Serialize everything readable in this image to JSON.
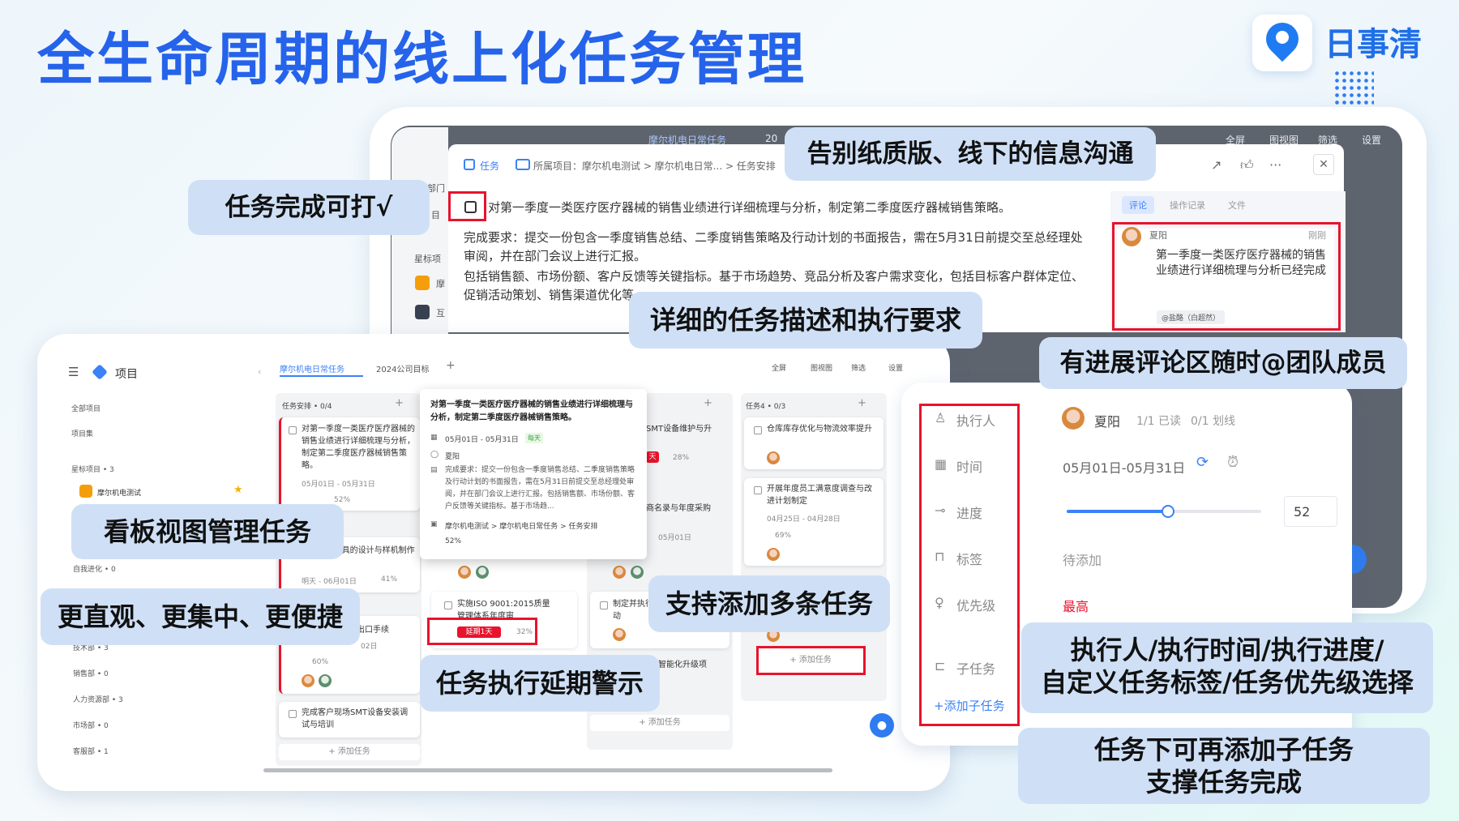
{
  "headline": "全生命周期的线上化任务管理",
  "brand": {
    "name": "日事清",
    "color": "#1f6fe8"
  },
  "colors": {
    "accent": "#2563eb",
    "alert": "#e8132c",
    "callout_bg": "#cfe0f6"
  },
  "callouts": {
    "complete": "任务完成可打√",
    "paperless": "告别纸质版、线下的信息沟通",
    "description": "详细的任务描述和执行要求",
    "comment": "有进展评论区随时@团队成员",
    "kanban": "看板视图管理任务",
    "intuitive": "更直观、更集中、更便捷",
    "multi": "支持添加多条任务",
    "delay": "任务执行延期警示",
    "fields_line1": "执行人/执行时间/执行进度/",
    "fields_line2": "自定义任务标签/任务优先级选择",
    "subtask_line1": "任务下可再添加子任务",
    "subtask_line2": "支撑任务完成"
  },
  "back_window": {
    "nav_title": "项目",
    "tab_active": "摩尔机电日常任务",
    "tab_other": "20",
    "toolbar": [
      "全屏",
      "图视图",
      "筛选",
      "设置"
    ],
    "strip_items": [
      "部门",
      "目",
      "星标项",
      "摩",
      "互"
    ]
  },
  "modal": {
    "type_tag": "任务",
    "breadcrumb": "所属项目：摩尔机电测试 > 摩尔机电日常... > 任务安排",
    "task_title": "对第一季度一类医疗医疗器械的销售业绩进行详细梳理与分析，制定第二季度医疗器械销售策略。",
    "para1": "完成要求：提交一份包含一季度销售总结、二季度销售策略及行动计划的书面报告，需在5月31日前提交至总经理处审阅，并在部门会议上进行汇报。",
    "para2": "包括销售额、市场份额、客户反馈等关键指标。基于市场趋势、竞品分析及客户需求变化，包括目标客户群体定位、促销活动策划、销售渠道优化等。",
    "side_tabs": [
      "评论",
      "操作记录",
      "文件"
    ],
    "comment": {
      "user": "夏阳",
      "time": "刚刚",
      "text": "第一季度一类医疗医疗器械的销售业绩进行详细梳理与分析已经完成",
      "mention": "@盐酪（白超然）"
    }
  },
  "front_window": {
    "nav_title": "项目",
    "tab_active": "摩尔机电日常任务",
    "tab_other": "2024公司目标",
    "toolbar": [
      "全屏",
      "图视图",
      "筛选",
      "设置"
    ],
    "sidebar": {
      "all": "全部项目",
      "sets": "项目集",
      "starred": "星标项目 • 3",
      "starred_item": "摩尔机电测试",
      "groups": [
        "自我进化 • 0",
        "技术部 • 3",
        "销售部 • 0",
        "人力资源部 • 3",
        "市场部 • 0",
        "客服部 • 1"
      ]
    },
    "col1": {
      "header": "任务安排 • 0/4",
      "card1_text": "对第一季度一类医疗医疗器械的销售业绩进行详细梳理与分析，制定第二季度医疗器械销售策略。",
      "card1_date": "05月01日 - 05月31日",
      "card1_pct": "52%",
      "card2_text": "LED照明灯具的设计与样机制作",
      "card2_date": "明天 - 06月01日",
      "card2_pct": "41%",
      "card3_text": "出口手续",
      "card3_date": "02日",
      "card3_pct": "60%",
      "card4_text": "完成客户现场SMT设备安装调试与培训",
      "add": "+ 添加任务"
    },
    "popup": {
      "title": "对第一季度一类医疗医疗器械的销售业绩进行详细梳理与分析，制定第二季度医疗器械销售策略。",
      "date": "05月01日 - 05月31日",
      "date_tag": "每天",
      "owner": "夏阳",
      "desc": "完成要求：提交一份包含一季度销售总结、二季度销售策略及行动计划的书面报告，需在5月31日前提交至总经理处审阅，并在部门会议上进行汇报。包括销售额、市场份额、客户反馈等关键指标。基于市场趋...",
      "path": "摩尔机电测试 > 摩尔机电日常任务 > 任务安排",
      "pct": "52%"
    },
    "col2": {
      "card_iso": "实施ISO 9001:2015质量管理体系年度审",
      "delay_tag": "延期1天",
      "delay_pct": "32%"
    },
    "col3": {
      "card1": "SMT设备维护与升",
      "card1_tag": "天",
      "card1_pct": "28%",
      "card2": "商名录与年度采购",
      "card2_date": "05月01日",
      "card3": "制定并执行 动",
      "card4": "智能化升级项",
      "add": "+ 添加任务"
    },
    "col4": {
      "header": "任务4 • 0/3",
      "card1": "仓库库存优化与物流效率提升",
      "card2": "开展年度员工满意度调查与改进计划制定",
      "card2_date": "04月25日 - 04月28日",
      "card2_pct": "69%",
      "add": "+ 添加任务"
    }
  },
  "detail": {
    "labels": {
      "owner": "执行人",
      "time": "时间",
      "progress": "进度",
      "tag": "标签",
      "priority": "优先级",
      "subtask": "子任务",
      "add_subtask": "+添加子任务"
    },
    "owner_name": "夏阳",
    "read": "1/1 已读",
    "marked": "0/1 划线",
    "date_range": "05月01日-05月31日",
    "progress_value": 52,
    "progress_text": "52",
    "tag_value": "待添加",
    "priority_value": "最高"
  }
}
